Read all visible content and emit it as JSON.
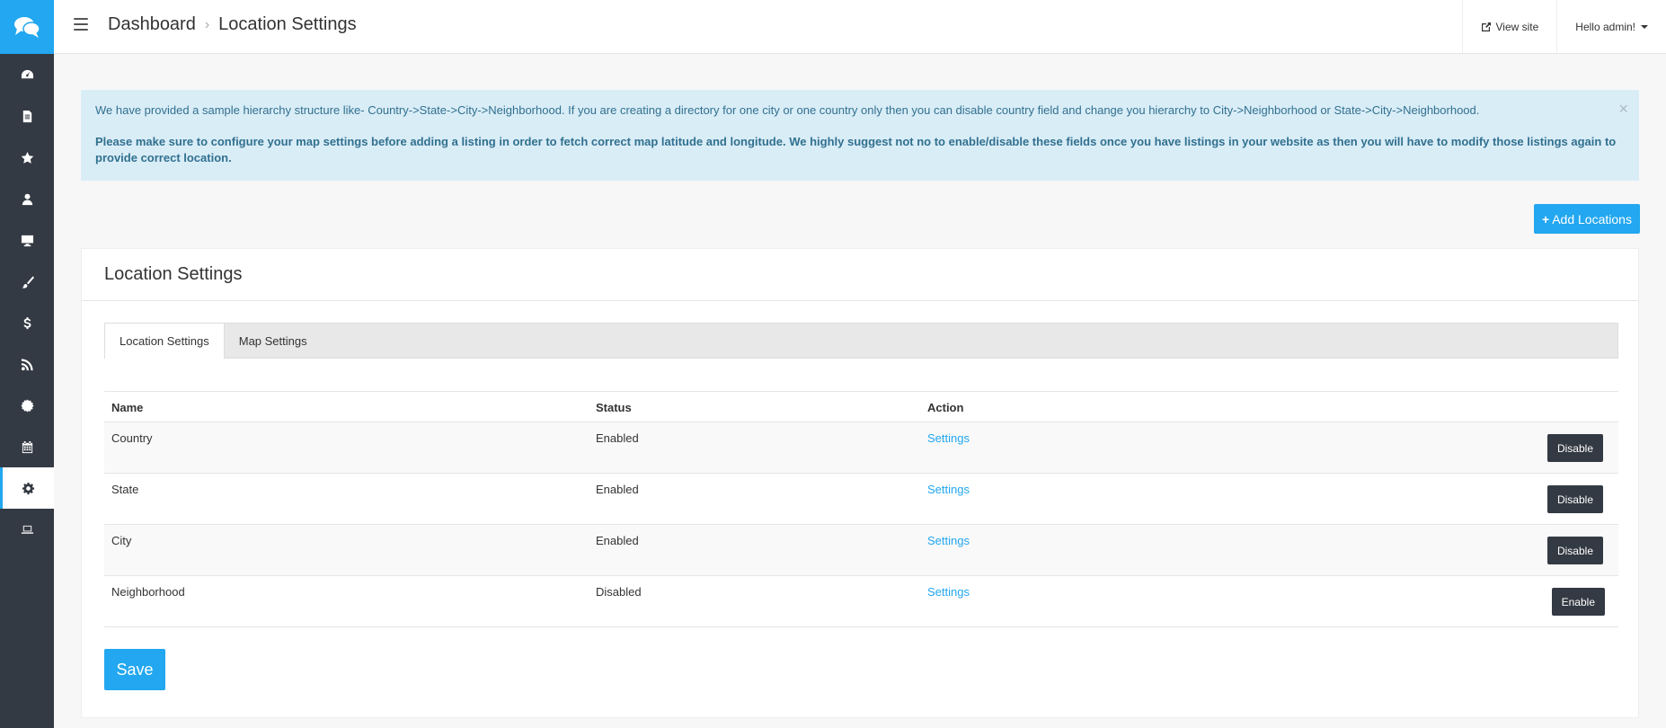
{
  "sidebar": {
    "logo_icon": "chat-bubbles-icon",
    "items": [
      {
        "icon": "dashboard-icon"
      },
      {
        "icon": "file-icon"
      },
      {
        "icon": "star-icon"
      },
      {
        "icon": "user-icon"
      },
      {
        "icon": "desktop-icon"
      },
      {
        "icon": "paint-brush-icon"
      },
      {
        "icon": "dollar-icon"
      },
      {
        "icon": "rss-icon"
      },
      {
        "icon": "certificate-icon"
      },
      {
        "icon": "calendar-icon"
      },
      {
        "icon": "gear-icon",
        "active": true
      },
      {
        "icon": "laptop-icon"
      }
    ],
    "accent": "#22a7f0",
    "background": "#343a43"
  },
  "header": {
    "breadcrumb": [
      "Dashboard",
      "Location Settings"
    ],
    "view_site_label": "View site",
    "user_menu_label": "Hello admin!"
  },
  "alert": {
    "message": "We have provided a sample hierarchy structure like- Country->State->City->Neighborhood. If you are creating a directory for one city or one country only then you can disable country field and change you hierarchy to City->Neighborhood or State->City->Neighborhood.",
    "warning": "Please make sure to configure your map settings before adding a listing in order to fetch correct map latitude and longitude. We highly suggest not no to enable/disable these fields once you have listings in your website as then you will have to modify those listings again to provide correct location.",
    "close_label": "×"
  },
  "add_button_label": "Add Locations",
  "panel": {
    "title": "Location Settings",
    "tabs": [
      {
        "label": "Location Settings",
        "active": true
      },
      {
        "label": "Map Settings",
        "active": false
      }
    ],
    "table": {
      "headers": [
        "Name",
        "Status",
        "Action"
      ],
      "rows": [
        {
          "name": "Country",
          "status": "Enabled",
          "action": "Settings",
          "button": "Disable"
        },
        {
          "name": "State",
          "status": "Enabled",
          "action": "Settings",
          "button": "Disable"
        },
        {
          "name": "City",
          "status": "Enabled",
          "action": "Settings",
          "button": "Disable"
        },
        {
          "name": "Neighborhood",
          "status": "Disabled",
          "action": "Settings",
          "button": "Enable"
        }
      ]
    },
    "save_label": "Save"
  }
}
